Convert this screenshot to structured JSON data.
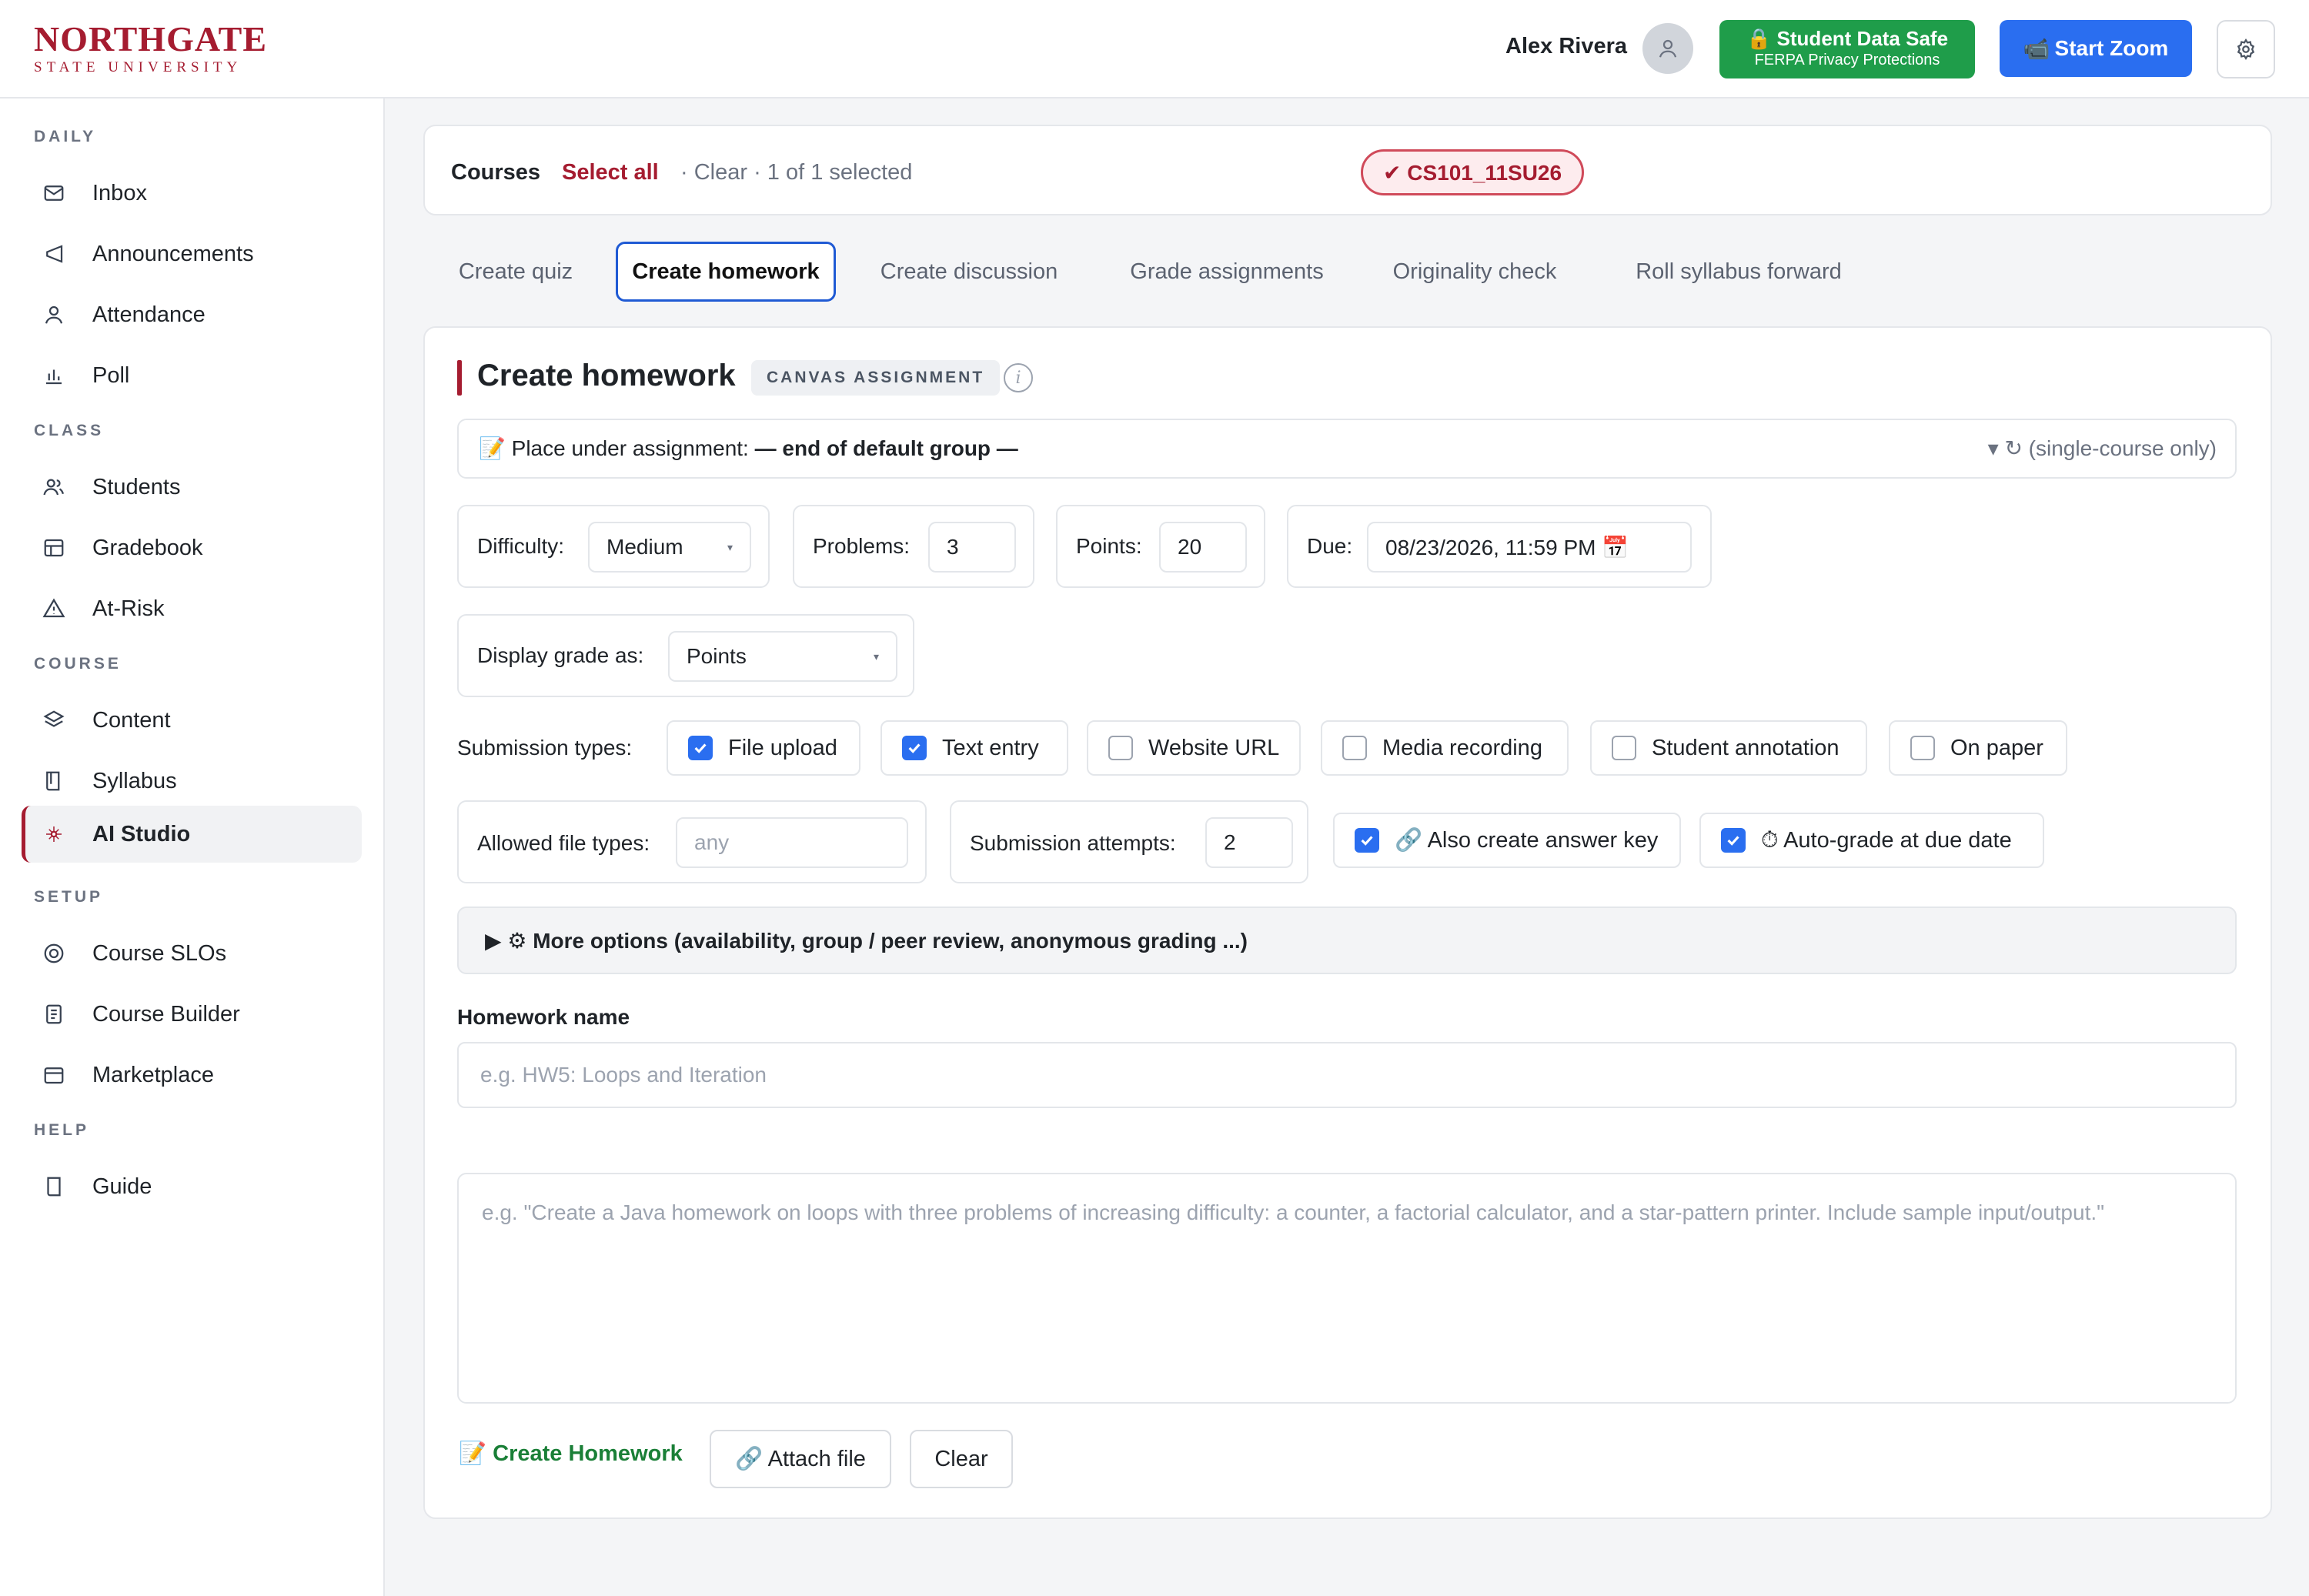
{
  "header": {
    "logo_main": "NORTHGATE",
    "logo_sub": "STATE UNIVERSITY",
    "user_name": "Alex Rivera",
    "safe_title": "🔒 Student Data Safe",
    "safe_sub": "FERPA Privacy Protections",
    "zoom_label": "Start Zoom",
    "zoom_icon": "📹"
  },
  "sidebar": {
    "sections": {
      "daily": "DAILY",
      "class": "CLASS",
      "course": "COURSE",
      "setup": "SETUP",
      "help": "HELP"
    },
    "items": {
      "inbox": "Inbox",
      "announcements": "Announcements",
      "attendance": "Attendance",
      "poll": "Poll",
      "students": "Students",
      "gradebook": "Gradebook",
      "at_risk": "At-Risk",
      "content": "Content",
      "syllabus": "Syllabus",
      "ai_studio": "AI Studio",
      "course_slos": "Course SLOs",
      "course_builder": "Course Builder",
      "marketplace": "Marketplace",
      "guide": "Guide"
    }
  },
  "courses": {
    "label": "Courses",
    "select_all": "Select all",
    "status": "· Clear · 1 of 1 selected",
    "chip": "✔ CS101_11SU26"
  },
  "tabs": {
    "create_quiz": "Create quiz",
    "create_homework": "Create homework",
    "create_discussion": "Create discussion",
    "grade_assignments": "Grade assignments",
    "originality_check": "Originality check",
    "roll_syllabus": "Roll syllabus forward"
  },
  "panel": {
    "title": "Create homework",
    "badge": "CANVAS ASSIGNMENT",
    "info": "i",
    "placement_prefix": "📝 Place under assignment: ",
    "placement_value": "— end of default group —",
    "placement_note": "▾ ↻ (single-course only)",
    "difficulty_label": "Difficulty:",
    "difficulty_value": "Medium",
    "problems_label": "Problems:",
    "problems_value": "3",
    "points_label": "Points:",
    "points_value": "20",
    "due_label": "Due:",
    "due_value": "08/23/2026, 11:59 PM 📅",
    "display_grade_label": "Display grade as:",
    "display_grade_value": "Points",
    "submission_types_label": "Submission types:",
    "submission_types": {
      "file_upload": "File upload",
      "text_entry": "Text entry",
      "website_url": "Website URL",
      "media_recording": "Media recording",
      "student_annotation": "Student annotation",
      "on_paper": "On paper"
    },
    "allowed_file_types_label": "Allowed file types:",
    "allowed_file_types_placeholder": "any",
    "attempts_label": "Submission attempts:",
    "attempts_value": "2",
    "answer_key_label": "🔗 Also create answer key",
    "auto_grade_label": "⏱ Auto-grade at due date",
    "more_options": "▶ ⚙ More options (availability, group / peer review, anonymous grading ...)",
    "homework_name_label": "Homework name",
    "homework_name_placeholder": "e.g. HW5: Loops and Iteration",
    "prompt_placeholder": "e.g. \"Create a Java homework on loops with three problems of increasing difficulty: a counter, a factorial calculator, and a star-pattern printer. Include sample input/output.\"",
    "create_button": "📝 Create Homework",
    "attach_button": "🔗 Attach file",
    "clear_button": "Clear"
  },
  "colors": {
    "brand": "#a51c30",
    "safe_green": "#1f9d4a",
    "zoom_blue": "#2a6ef0",
    "checkbox_blue": "#2a6ef0",
    "create_green": "#1a7f37"
  }
}
